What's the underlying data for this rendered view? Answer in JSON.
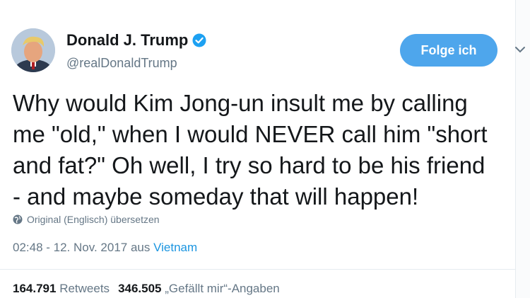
{
  "author": {
    "display_name": "Donald J. Trump",
    "handle": "@realDonaldTrump",
    "verified_icon": "verified-badge-icon",
    "verified_color": "#1da1f2"
  },
  "follow_button": {
    "label": "Folge ich",
    "color": "#4ea6ec"
  },
  "menu_icon": "chevron-down-icon",
  "tweet": {
    "text": "Why would Kim Jong-un insult me by calling\nme \"old,\" when I would NEVER call him \"short\nand fat?\" Oh well, I try so hard to be his friend\n- and maybe someday that will happen!"
  },
  "translate": {
    "icon": "globe-icon",
    "label": "Original (Englisch) übersetzen"
  },
  "meta": {
    "timestamp": "02:48 - 12. Nov. 2017 aus ",
    "location": "Vietnam"
  },
  "stats": {
    "retweets_count": "164.791",
    "retweets_label": "Retweets",
    "likes_count": "346.505",
    "likes_label": "„Gefällt mir“-Angaben"
  }
}
